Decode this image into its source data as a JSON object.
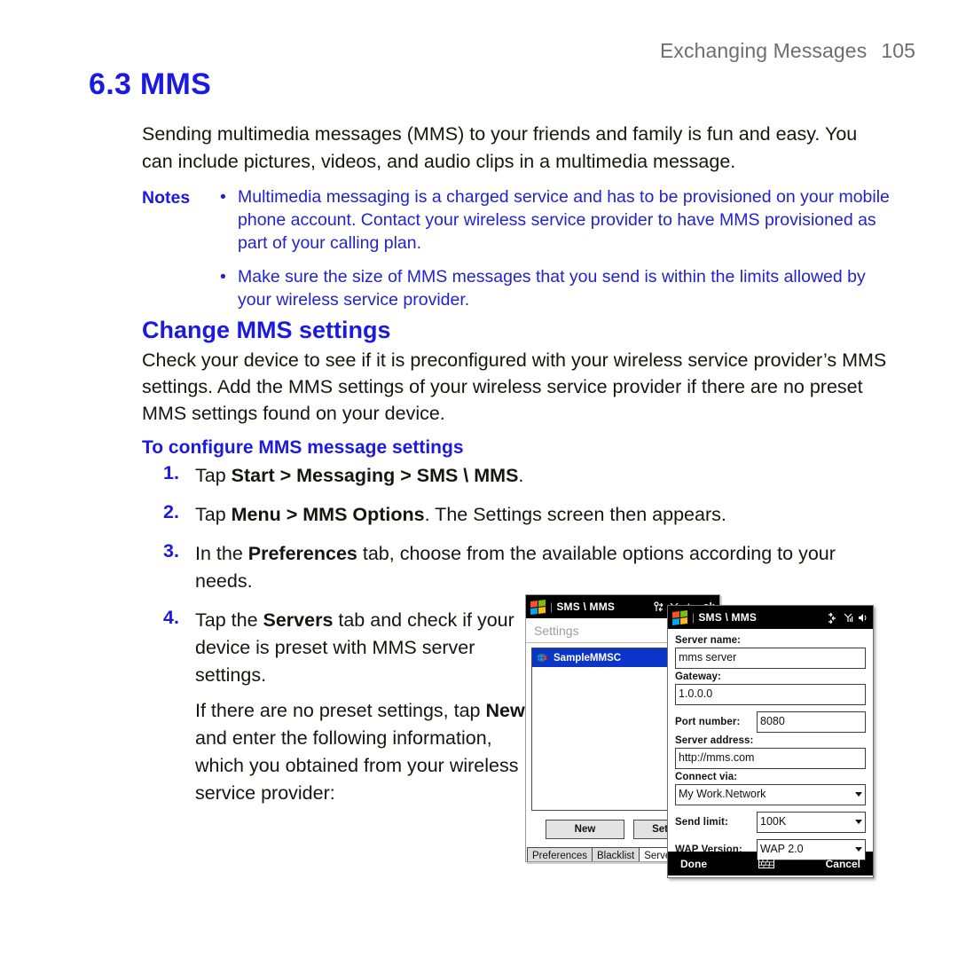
{
  "running_head": {
    "section": "Exchanging Messages",
    "page_number": "105"
  },
  "heading": {
    "number_title": "6.3 MMS"
  },
  "intro": "Sending multimedia messages (MMS) to your friends and family is fun and easy. You can include pictures, videos, and audio clips in a multimedia message.",
  "notes": {
    "label": "Notes",
    "bullet": "•",
    "items": [
      "Multimedia messaging is a charged service and has to be provisioned on your mobile phone account. Contact your wireless service provider to have MMS provisioned as part of your calling plan.",
      "Make sure the size of MMS messages that you send is within the limits allowed by your wireless service provider."
    ]
  },
  "section": {
    "title": "Change MMS settings",
    "paragraph": "Check your device to see if it is preconfigured with your wireless service provider’s MMS settings. Add the MMS settings of your wireless service provider if there are no preset MMS settings found on your device.",
    "subtitle": "To configure MMS message settings"
  },
  "steps": [
    {
      "num": "1.",
      "html": "Tap <b>Start > Messaging > SMS \\ MMS</b>."
    },
    {
      "num": "2.",
      "html": "Tap <b>Menu > MMS Options</b>. The Settings screen then appears."
    },
    {
      "num": "3.",
      "html": "In the <b>Preferences</b> tab, choose from the available options according to your needs."
    },
    {
      "num": "4.",
      "html": "Tap the <b>Servers</b> tab and check if your device is preset with MMS server settings."
    }
  ],
  "step4_sub": "If there are no preset settings, tap <b>New</b> and enter the following information, which you obtained from your wireless service provider:",
  "device_back": {
    "titlebar": {
      "app": "SMS \\ MMS",
      "separator": "|",
      "ok_label": "ok"
    },
    "settings_label": "Settings",
    "list_items": [
      "SampleMMSC"
    ],
    "buttons": [
      "New",
      "Set As D"
    ],
    "tabs": [
      "Preferences",
      "Blacklist",
      "Servers"
    ],
    "active_tab": "Servers"
  },
  "device_front": {
    "titlebar": {
      "app": "SMS \\ MMS",
      "separator": "|"
    },
    "fields": {
      "server_name_label": "Server name:",
      "server_name_value": "mms server",
      "gateway_label": "Gateway:",
      "gateway_value": "1.0.0.0",
      "port_label": "Port number:",
      "port_value": "8080",
      "address_label": "Server address:",
      "address_value": "http://mms.com",
      "connect_label": "Connect via:",
      "connect_value": "My Work.Network",
      "send_limit_label": "Send limit:",
      "send_limit_value": "100K",
      "wap_label": "WAP Version:",
      "wap_value": "WAP 2.0"
    },
    "commands": {
      "done": "Done",
      "cancel": "Cancel"
    }
  },
  "colors": {
    "accent_blue": "#1a1ae0",
    "note_blue": "#2323cc",
    "head_gray": "#6e6e6e",
    "selection_blue": "#0a35c8"
  }
}
